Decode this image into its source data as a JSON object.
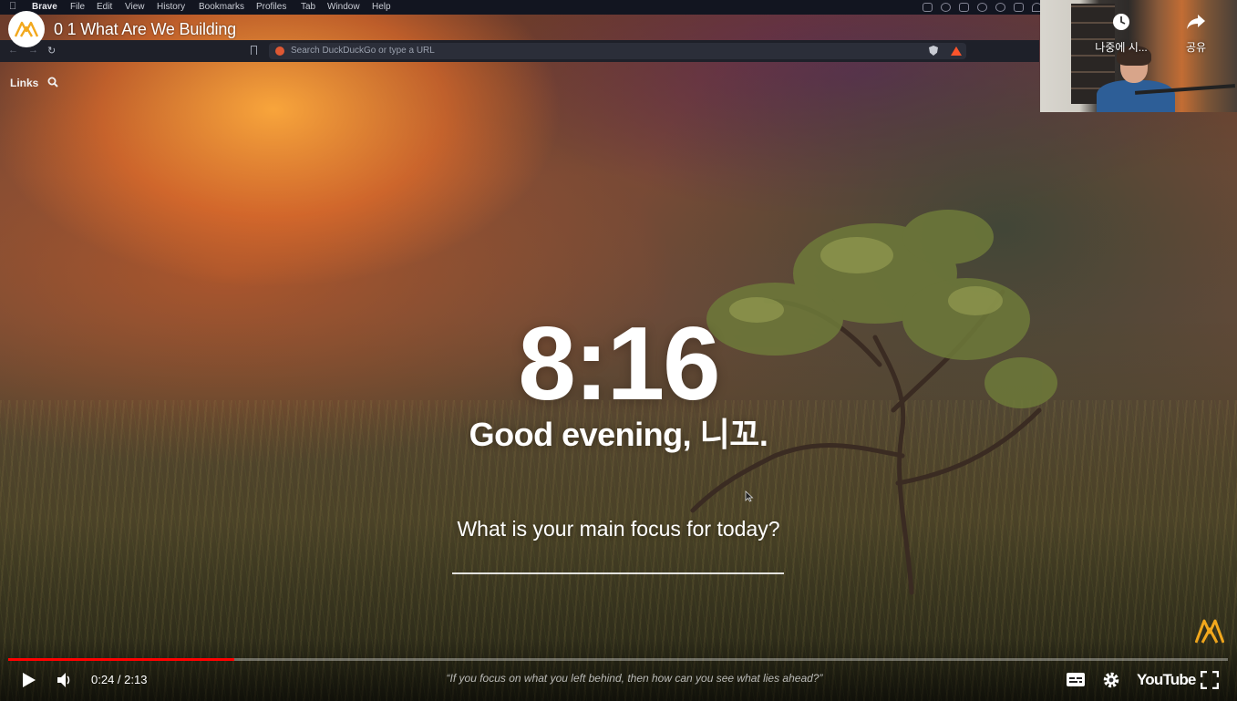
{
  "menubar": {
    "app": "Brave",
    "items": [
      "File",
      "Edit",
      "View",
      "History",
      "Bookmarks",
      "Profiles",
      "Tab",
      "Window",
      "Help"
    ]
  },
  "video": {
    "title": "0 1 What Are We Building"
  },
  "browser": {
    "url_placeholder": "Search DuckDuckGo or type a URL"
  },
  "momentum": {
    "links_label": "Links",
    "time": "8:16",
    "greeting": "Good evening, 니꼬.",
    "focus_question": "What is your main focus for today?",
    "quote": "“If you focus on what you left behind, then how can you see what lies ahead?”"
  },
  "overlay": {
    "watch_later": "나중에 시...",
    "share": "공유"
  },
  "player": {
    "current_time": "0:24",
    "duration": "2:13",
    "time_display": "0:24 / 2:13",
    "progress": 0.185,
    "brand": "YouTube",
    "accent_color": "#ff0000"
  },
  "colors": {
    "brand_orange": "#f2a81d",
    "menubar_bg": "#121520",
    "browser_bg": "#1e2029"
  }
}
